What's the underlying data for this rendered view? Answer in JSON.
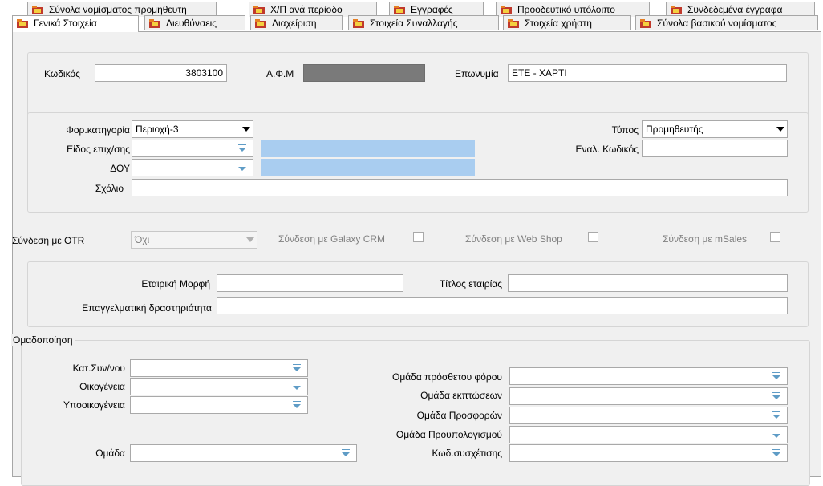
{
  "tabs_row1": [
    {
      "label": "Σύνολα νομίσματος προμηθευτή",
      "icon": "folder-icon"
    },
    {
      "label": "Χ/Π ανά περίοδο",
      "icon": "folder-icon"
    },
    {
      "label": "Εγγραφές",
      "icon": "folder-icon"
    },
    {
      "label": "Προοδευτικό υπόλοιπο",
      "icon": "folder-icon"
    },
    {
      "label": "Συνδεδεμένα έγγραφα",
      "icon": "folder-icon"
    }
  ],
  "tabs_row2": [
    {
      "label": "Γενικά Στοιχεία",
      "icon": "folder-icon",
      "active": true
    },
    {
      "label": "Διευθύνσεις",
      "icon": "folder-icon"
    },
    {
      "label": "Διαχείριση",
      "icon": "folder-icon"
    },
    {
      "label": "Στοιχεία Συναλλαγής",
      "icon": "folder-icon"
    },
    {
      "label": "Στοιχεία χρήστη",
      "icon": "folder-icon"
    },
    {
      "label": "Σύνολα βασικού νομίσματος",
      "icon": "folder-icon"
    }
  ],
  "header": {
    "code_label": "Κωδικός",
    "code_value": "3803100",
    "afm_label": "Α.Φ.Μ",
    "name_label": "Επωνυμία",
    "name_value": "ΕΤΕ - ΧΑΡΤΙ"
  },
  "tax": {
    "category_label": "Φορ.κατηγορία",
    "category_value": "Περιοχή-3",
    "type_label": "Τύπος",
    "type_value": "Προμηθευτής",
    "business_label": "Είδος επιχ/σης",
    "alt_code_label": "Εναλ. Κωδικός",
    "doy_label": "ΔΟΥ",
    "comment_label": "Σχόλιο"
  },
  "links": {
    "otr_label": "Σύνδεση με OTR",
    "otr_value": "Όχι",
    "crm_label": "Σύνδεση με Galaxy CRM",
    "webshop_label": "Σύνδεση με Web Shop",
    "msales_label": "Σύνδεση με mSales"
  },
  "company": {
    "form_label": "Εταιρική Μορφή",
    "title_label": "Τίτλος εταιρίας",
    "activity_label": "Επαγγελματική δραστηριότητα"
  },
  "grouping": {
    "legend": "Ομαδοποίηση",
    "category_label": "Κατ.Συν/νου",
    "family_label": "Οικογένεια",
    "subfamily_label": "Υποοικογένεια",
    "group_label": "Ομάδα",
    "extra_tax_label": "Ομάδα πρόσθετου φόρου",
    "discount_label": "Ομάδα εκπτώσεων",
    "offers_label": "Ομάδα Προσφορών",
    "budget_label": "Ομάδα Προυπολογισμού",
    "relation_label": "Κωδ.συσχέτισης"
  },
  "colors": {
    "highlight": "#a9cdf0",
    "panel": "#f0f0f0"
  }
}
